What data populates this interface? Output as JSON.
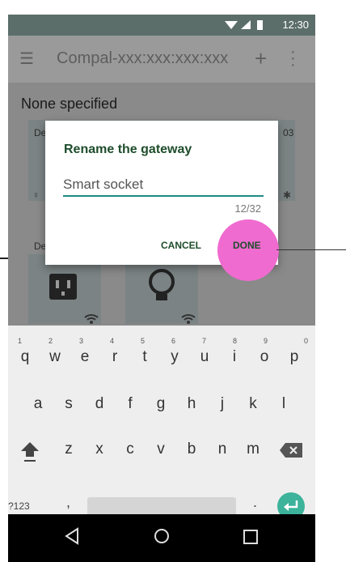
{
  "status": {
    "time": "12:30",
    "icons": [
      "wifi-icon",
      "signal-icon",
      "battery-icon"
    ]
  },
  "appbar": {
    "title": "Compal-xxx:xxx:xxx:xxx",
    "menu_icon": "menu-icon",
    "add_icon": "plus-icon",
    "more_icon": "more-vert-icon"
  },
  "content": {
    "header": "None specified",
    "cards": [
      {
        "label_left": "De",
        "label_right": "03"
      },
      {
        "label_left": "De",
        "label_right": ""
      }
    ]
  },
  "dialog": {
    "title": "Rename the gateway",
    "input_value": "Smart socket",
    "counter": "12/32",
    "cancel_label": "CANCEL",
    "done_label": "DONE"
  },
  "keyboard": {
    "row1": [
      "q",
      "w",
      "e",
      "r",
      "t",
      "y",
      "u",
      "i",
      "o",
      "p"
    ],
    "row1_numbers": [
      "1",
      "2",
      "3",
      "4",
      "5",
      "6",
      "7",
      "8",
      "9",
      "0"
    ],
    "row2": [
      "a",
      "s",
      "d",
      "f",
      "g",
      "h",
      "j",
      "k",
      "l"
    ],
    "row3": [
      "z",
      "x",
      "c",
      "v",
      "b",
      "n",
      "m"
    ],
    "symbols_label": "?123",
    "comma": ",",
    "period": ".",
    "accent_color": "#3cb39a"
  },
  "colors": {
    "highlight": "#f06bd0",
    "dialog_title": "#1e4d2b",
    "input_underline": "#1e8a82"
  }
}
